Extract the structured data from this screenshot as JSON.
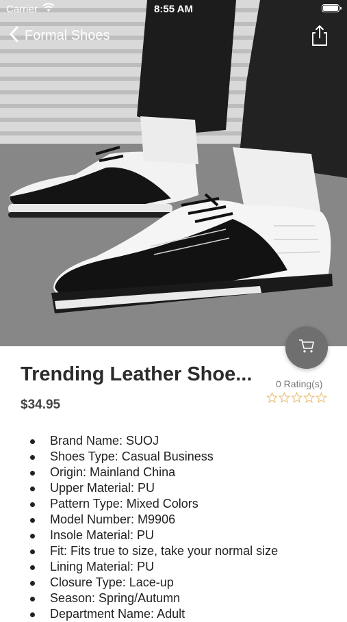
{
  "status_bar": {
    "carrier": "Carrier",
    "time": "8:55 AM"
  },
  "nav": {
    "back_title": "Formal Shoes"
  },
  "product": {
    "title": "Trending Leather Shoe...",
    "price": "$34.95",
    "rating_text": "0 Rating(s)",
    "rating_value": 0,
    "rating_max": 5
  },
  "specs": [
    "Brand Name: SUOJ",
    "Shoes Type: Casual Business",
    "Origin: Mainland China",
    "Upper Material: PU",
    "Pattern Type: Mixed Colors",
    "Model Number: M9906",
    "Insole Material: PU",
    "Fit: Fits true to size, take your normal size",
    "Lining Material: PU",
    "Closure Type: Lace-up",
    "Season: Spring/Autumn",
    "Department Name: Adult"
  ],
  "colors": {
    "accent_star": "#e8c27a",
    "fab": "#6f6f6f"
  }
}
